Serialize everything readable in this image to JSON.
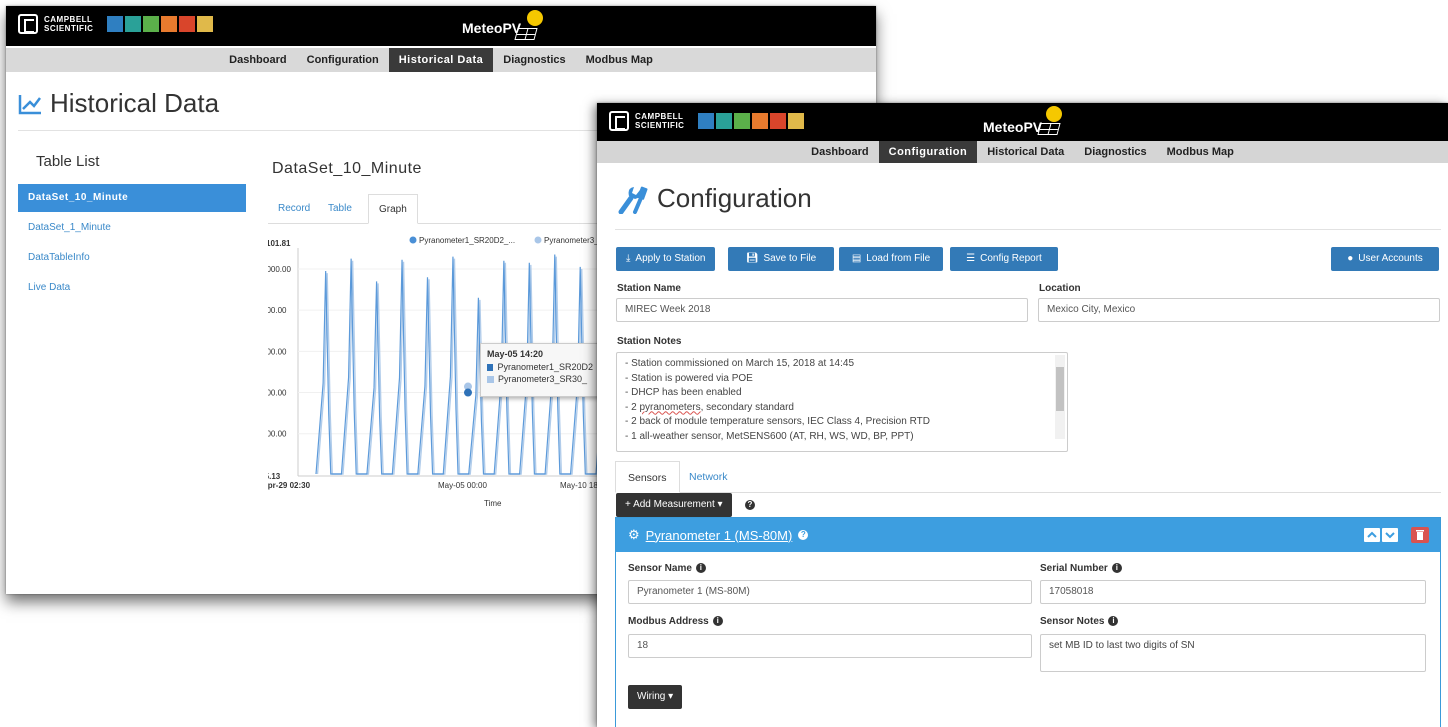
{
  "brand": {
    "company_line1": "CAMPBELL",
    "company_line2": "SCIENTIFIC",
    "product": "MeteoPV",
    "tile_colors": [
      "#2f7fc1",
      "#2aa198",
      "#5bb04a",
      "#e87a2e",
      "#d9452b",
      "#e0b94a"
    ]
  },
  "nav": [
    "Dashboard",
    "Configuration",
    "Historical Data",
    "Diagnostics",
    "Modbus Map"
  ],
  "historical": {
    "title": "Historical Data",
    "table_list_title": "Table List",
    "tables": [
      "DataSet_10_Minute",
      "DataSet_1_Minute",
      "DataTableInfo",
      "Live Data"
    ],
    "dataset_title": "DataSet_10_Minute",
    "tabs": [
      "Record",
      "Table",
      "Graph"
    ],
    "active_tab": "Graph",
    "tooltip": {
      "time": "May-05 14:20",
      "rows": [
        "Pyranometer1_SR20D2",
        "Pyranometer3_SR30_"
      ]
    }
  },
  "chart_data": {
    "type": "line",
    "legend": [
      "Pyranometer1_SR20D2_...",
      "Pyranometer3_..."
    ],
    "ytick_labels": [
      "1101.81",
      "1000.00",
      "800.00",
      "600.00",
      "400.00",
      "200.00",
      "-5.13"
    ],
    "xtick_labels": [
      "Apr-29 02:30",
      "May-05 00:00",
      "May-10 18:"
    ],
    "xlabel": "Time",
    "ylim": [
      -5.13,
      1101.81
    ],
    "series": [
      {
        "name": "Pyranometer1_SR20D2_...",
        "color": "#4a8fd6",
        "daily_peaks": [
          990,
          1050,
          940,
          1045,
          960,
          1060,
          860,
          1040,
          1030,
          1070,
          1010,
          1050,
          1000,
          1060,
          980,
          1045,
          1090,
          950,
          1055,
          1080,
          1040,
          1060
        ]
      },
      {
        "name": "Pyranometer3_...",
        "color": "#a9c6e8",
        "daily_peaks": [
          980,
          1040,
          930,
          1035,
          950,
          1050,
          850,
          1030,
          1020,
          1060,
          1000,
          1040,
          990,
          1050,
          970,
          1035,
          1080,
          940,
          1045,
          1070,
          1030,
          1050
        ]
      }
    ],
    "highlight_point": {
      "x": "May-05 14:20",
      "y": 400
    }
  },
  "configuration": {
    "title": "Configuration",
    "buttons": {
      "apply": "Apply to Station",
      "save": "Save to File",
      "load": "Load from File",
      "report": "Config Report",
      "users": "User Accounts"
    },
    "station_name_label": "Station Name",
    "station_name_value": "MIREC Week 2018",
    "location_label": "Location",
    "location_value": "Mexico City, Mexico",
    "station_notes_label": "Station Notes",
    "station_notes": [
      "- Station commissioned on March 15, 2018 at 14:45",
      "- Station is powered via POE",
      "- DHCP has been enabled",
      "- 2 pyranometers, secondary standard",
      "- 2 back of module temperature sensors, IEC Class 4, Precision RTD",
      "- 1 all-weather sensor, MetSENS600 (AT, RH, WS, WD, BP, PPT)"
    ],
    "tabs": [
      "Sensors",
      "Network"
    ],
    "add_measurement": "+ Add Measurement ▾",
    "sensor": {
      "title": "Pyranometer 1 (MS-80M)",
      "sensor_name_label": "Sensor Name",
      "sensor_name_value": "Pyranometer 1 (MS-80M)",
      "serial_label": "Serial Number",
      "serial_value": "17058018",
      "modbus_label": "Modbus Address",
      "modbus_value": "18",
      "notes_label": "Sensor Notes",
      "notes_value": "set MB ID to last two digits of SN",
      "wiring": "Wiring ▾"
    }
  }
}
